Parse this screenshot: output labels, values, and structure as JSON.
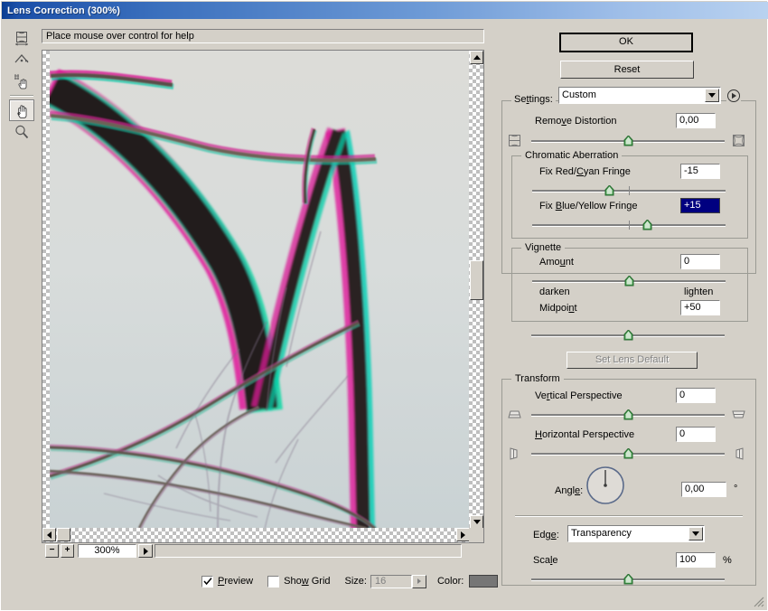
{
  "window": {
    "title": "Lens Correction (300%)",
    "title_accent": "#0b3d91"
  },
  "help": {
    "text": "Place mouse over control for help"
  },
  "toolbar": {
    "tools": [
      {
        "name": "remove-distortion-tool",
        "label": "Remove Distortion Tool",
        "selected": false
      },
      {
        "name": "straighten-tool",
        "label": "Straighten Tool",
        "selected": false
      },
      {
        "name": "move-grid-tool",
        "label": "Move Grid Tool",
        "selected": false
      },
      {
        "name": "hand-tool",
        "label": "Hand Tool",
        "selected": true
      },
      {
        "name": "zoom-tool",
        "label": "Zoom Tool",
        "selected": false
      }
    ]
  },
  "preview": {
    "zoom_level": "300%",
    "zoom_out_label": "−",
    "zoom_in_label": "+",
    "preview_checkbox": {
      "label": "Preview",
      "checked": true
    },
    "show_grid_checkbox": {
      "label": "Show Grid",
      "checked": false
    },
    "size_label": "Size:",
    "size_value": "16",
    "size_enabled": false,
    "color_label": "Color:",
    "color_value": "#767676"
  },
  "buttons": {
    "ok": "OK",
    "reset": "Reset",
    "set_lens_default": "Set Lens Default",
    "set_lens_default_enabled": false
  },
  "settings": {
    "label": "Settings:",
    "value": "Custom",
    "menu_icon": "flyout-menu-icon"
  },
  "remove_distortion": {
    "label": "Remove Distortion",
    "value": "0,00",
    "slider_percent": 50,
    "icon_left": "barrel-distortion-icon",
    "icon_right": "pincushion-distortion-icon"
  },
  "chromatic_aberration": {
    "legend": "Chromatic Aberration",
    "red_cyan": {
      "label_pre": "Fix Red/",
      "label_key": "C",
      "label_post": "yan Fringe",
      "value": "-15",
      "slider_percent": 42.5,
      "selected": false
    },
    "blue_yellow": {
      "label_pre": "Fix ",
      "label_key": "B",
      "label_post": "lue/Yellow Fringe",
      "value": "+15",
      "slider_percent": 57.5,
      "selected": true
    }
  },
  "vignette": {
    "legend": "Vignette",
    "amount": {
      "label": "Amount",
      "value": "0",
      "slider_percent": 50
    },
    "darken_label": "darken",
    "lighten_label": "lighten",
    "midpoint": {
      "label": "Midpoint",
      "value": "+50",
      "slider_percent": 50
    }
  },
  "transform": {
    "legend": "Transform",
    "vertical_perspective": {
      "label": "Vertical Perspective",
      "value": "0",
      "slider_percent": 50,
      "icon_left": "perspective-top-icon",
      "icon_right": "perspective-bottom-icon"
    },
    "horizontal_perspective": {
      "label": "Horizontal Perspective",
      "value": "0",
      "slider_percent": 50,
      "icon_left": "perspective-left-icon",
      "icon_right": "perspective-right-icon"
    },
    "angle": {
      "label": "Angle:",
      "value": "0,00",
      "unit": "°",
      "degrees": 0
    },
    "edge": {
      "label": "Edge:",
      "value": "Transparency"
    },
    "scale": {
      "label": "Scale",
      "value": "100",
      "unit": "%",
      "slider_percent": 50
    }
  }
}
